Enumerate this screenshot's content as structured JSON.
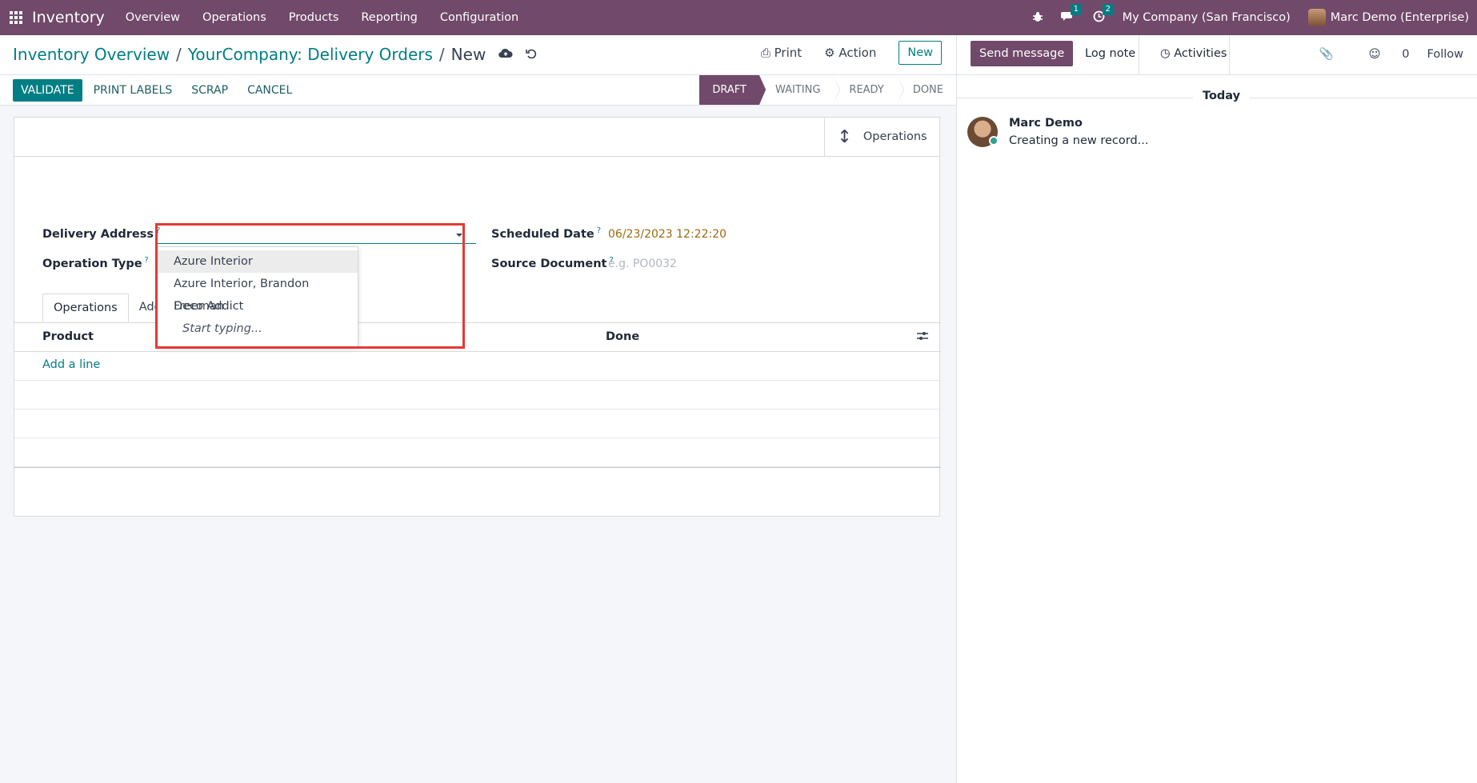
{
  "navbar": {
    "brand": "Inventory",
    "menu": [
      "Overview",
      "Operations",
      "Products",
      "Reporting",
      "Configuration"
    ],
    "messages_count": "1",
    "activities_count": "2",
    "company": "My Company (San Francisco)",
    "user": "Marc Demo (Enterprise)",
    "bar_color": "#71496a"
  },
  "breadcrumb": {
    "items": [
      "Inventory Overview",
      "YourCompany: Delivery Orders"
    ],
    "current": "New"
  },
  "control": {
    "print_label": "Print",
    "action_label": "Action",
    "new_label": "New"
  },
  "statusbar": {
    "buttons": [
      "VALIDATE",
      "PRINT LABELS",
      "SCRAP",
      "CANCEL"
    ],
    "stages": [
      "DRAFT",
      "WAITING",
      "READY",
      "DONE"
    ],
    "active_stage": "DRAFT"
  },
  "form": {
    "smart_button": "Operations",
    "delivery_address_label": "Delivery Address",
    "operation_type_label": "Operation Type",
    "scheduled_date_label": "Scheduled Date",
    "scheduled_date_value": "06/23/2023 12:22:20",
    "source_document_label": "Source Document",
    "source_document_placeholder": "e.g. PO0032",
    "help_mark": "?",
    "tabs": [
      "Operations",
      "Add"
    ],
    "table_headers": [
      "Product",
      "Done"
    ],
    "add_line": "Add a line"
  },
  "dropdown": {
    "items": [
      "Azure Interior",
      "Azure Interior, Brandon Freeman",
      "Deco Addict"
    ],
    "hint": "Start typing..."
  },
  "chatter": {
    "send_message": "Send message",
    "log_note": "Log note",
    "activities": "Activities",
    "followers_count": "0",
    "follow": "Follow",
    "date_separator": "Today",
    "message_author": "Marc Demo",
    "message_body": "Creating a new record..."
  },
  "colors": {
    "accent": "#017e84",
    "brand": "#71496a",
    "highlight": "#e53935"
  }
}
